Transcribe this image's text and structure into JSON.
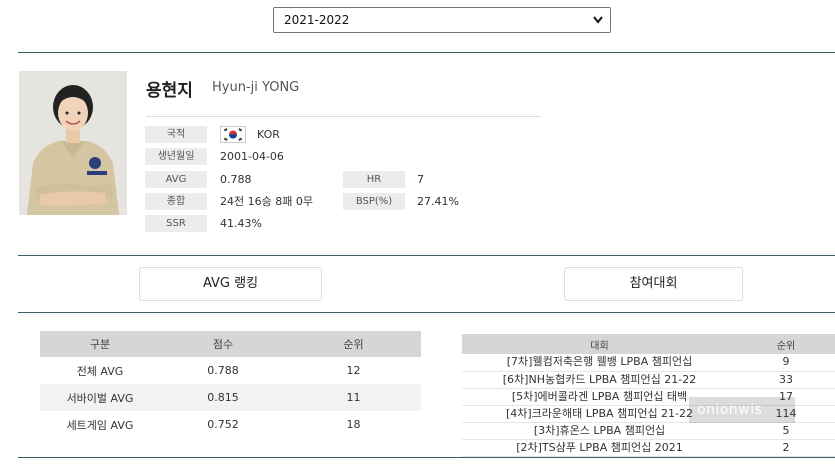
{
  "season_select": {
    "value": "2021-2022"
  },
  "player": {
    "name_ko": "용현지",
    "name_en": "Hyun-ji YONG",
    "nationality_label": "국적",
    "nationality": "KOR",
    "birth_label": "생년월일",
    "birth": "2001-04-06",
    "avg_label": "AVG",
    "avg": "0.788",
    "hr_label": "HR",
    "hr": "7",
    "overall_label": "종합",
    "overall": "24전 16승 8패 0무",
    "bsp_label": "BSP(%)",
    "bsp": "27.41%",
    "ssr_label": "SSR",
    "ssr": "41.43%"
  },
  "tabs": {
    "avg_ranking": "AVG 랭킹",
    "tournaments": "참여대회"
  },
  "avg_table": {
    "headers": [
      "구분",
      "점수",
      "순위"
    ],
    "rows": [
      [
        "전체 AVG",
        "0.788",
        "12"
      ],
      [
        "서바이벌 AVG",
        "0.815",
        "11"
      ],
      [
        "세트게임 AVG",
        "0.752",
        "18"
      ]
    ]
  },
  "tournament_table": {
    "headers": [
      "대회",
      "순위"
    ],
    "rows": [
      [
        "[7차]웰컴저축은행 웰뱅 LPBA 챔피언십",
        "9"
      ],
      [
        "[6차]NH농협카드 LPBA 챔피언십 21-22",
        "33"
      ],
      [
        "[5차]에버콜라겐 LPBA 챔피언십 태백",
        "17"
      ],
      [
        "[4차]크라운해태 LPBA 챔피언십 21-22",
        "114"
      ],
      [
        "[3차]휴온스 LPBA 챔피언십",
        "5"
      ],
      [
        "[2차]TS샴푸 LPBA 챔피언십 2021",
        "2"
      ]
    ]
  },
  "watermark": "onionwis",
  "colors": {
    "rule": "#3f5b66",
    "header_bg": "#d6d6d6",
    "label_bg": "#ececec",
    "flag_red": "#cd2e3a",
    "flag_blue": "#0047a0"
  }
}
